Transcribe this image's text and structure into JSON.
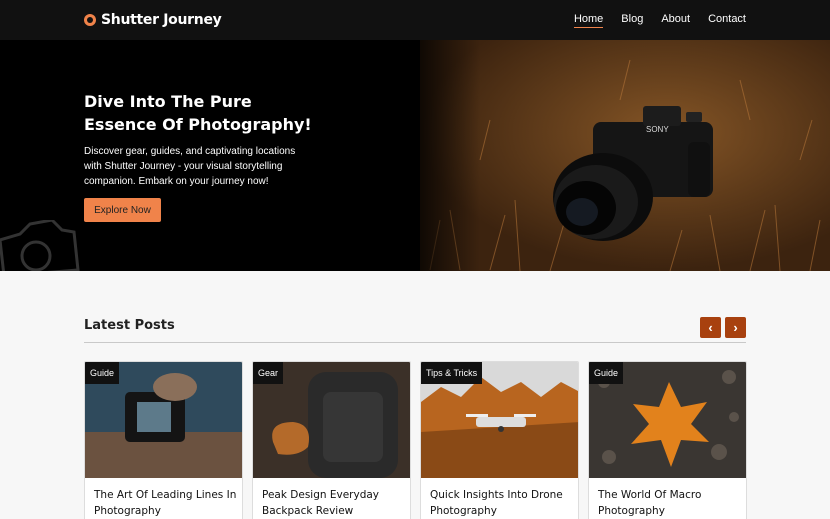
{
  "nav": {
    "logo_text": "Shutter Journey",
    "links": [
      {
        "label": "Home",
        "active": true
      },
      {
        "label": "Blog",
        "active": false
      },
      {
        "label": "About",
        "active": false
      },
      {
        "label": "Contact",
        "active": false
      }
    ]
  },
  "hero": {
    "title": "Dive Into The Pure Essence Of Photography!",
    "subtitle": "Discover gear, guides, and captivating locations with Shutter Journey - your visual storytelling companion. Embark on your journey now!",
    "button_label": "Explore Now",
    "camera_brand": "SONY"
  },
  "latest_posts": {
    "heading": "Latest Posts",
    "prev_label": "‹",
    "next_label": "›",
    "cards": [
      {
        "tag": "Guide",
        "title": "The Art Of Leading Lines In Photography",
        "image_icon": "camera-hand-photo"
      },
      {
        "tag": "Gear",
        "title": "Peak Design Everyday Backpack Review",
        "image_icon": "backpack-photo"
      },
      {
        "tag": "Tips & Tricks",
        "title": "Quick Insights Into Drone Photography",
        "image_icon": "drone-photo"
      },
      {
        "tag": "Guide",
        "title": "The World Of Macro Photography",
        "image_icon": "maple-leaf-photo"
      }
    ]
  },
  "colors": {
    "accent": "#f0834a",
    "arrow_bg": "#a8410f",
    "nav_bg": "#111111"
  }
}
